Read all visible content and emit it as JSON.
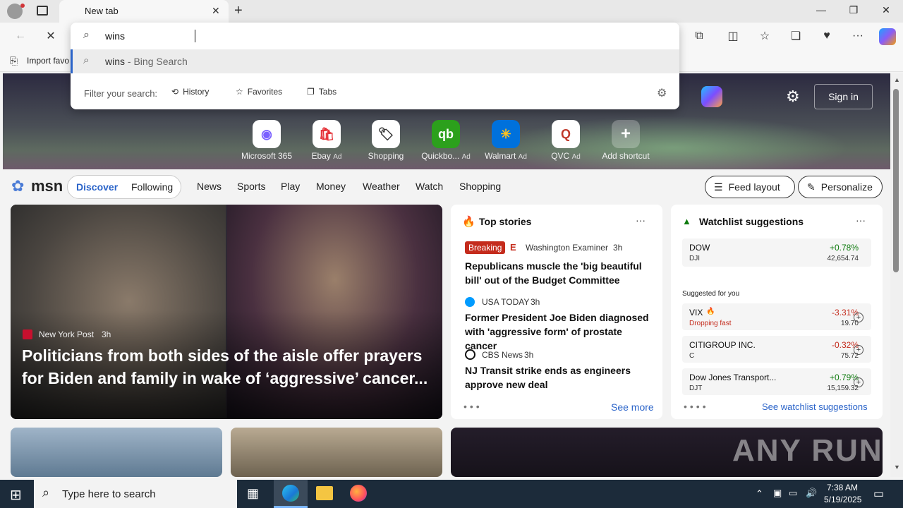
{
  "browser": {
    "tab_title": "New tab",
    "fav_label": "Import favo",
    "omnibox": {
      "input_value": "wins",
      "suggestion_query": "wins",
      "suggestion_sub": " - Bing Search",
      "filter_label": "Filter your search:",
      "filters": [
        "History",
        "Favorites",
        "Tabs"
      ]
    }
  },
  "shortcuts": [
    {
      "label": "Microsoft 365",
      "ad": "",
      "icon": "microsoft-365-icon"
    },
    {
      "label": "Ebay",
      "ad": "Ad",
      "icon": "ebay-icon"
    },
    {
      "label": "Shopping",
      "ad": "",
      "icon": "shopping-tag-icon"
    },
    {
      "label": "Quickbo...",
      "ad": "Ad",
      "icon": "quickbooks-icon"
    },
    {
      "label": "Walmart",
      "ad": "Ad",
      "icon": "walmart-icon"
    },
    {
      "label": "QVC",
      "ad": "Ad",
      "icon": "qvc-icon"
    },
    {
      "label": "Add shortcut",
      "ad": "",
      "icon": "plus-icon"
    }
  ],
  "header": {
    "sign_in": "Sign in"
  },
  "msn": {
    "logo": "msn",
    "tabs": [
      "Discover",
      "Following"
    ],
    "nav": [
      "News",
      "Sports",
      "Play",
      "Money",
      "Weather",
      "Watch",
      "Shopping"
    ],
    "feed_layout": "Feed layout",
    "personalize": "Personalize"
  },
  "hero_story": {
    "source": "New York Post",
    "age": "3h",
    "headline": "Politicians from both sides of the aisle offer prayers for Biden and family in wake of ‘aggressive’ cancer..."
  },
  "top_stories": {
    "title": "Top stories",
    "items": [
      {
        "badge": "Breaking",
        "source": "Washington Examiner",
        "age": "3h",
        "headline": "Republicans muscle the 'big beautiful bill' out of the Budget Committee"
      },
      {
        "badge": "",
        "source": "USA TODAY",
        "age": "3h",
        "headline": "Former President Joe Biden diagnosed with 'aggressive form' of prostate cancer"
      },
      {
        "badge": "",
        "source": "CBS News",
        "age": "3h",
        "headline": "NJ Transit strike ends as engineers approve new deal"
      }
    ],
    "see_more": "See more"
  },
  "watchlist": {
    "title": "Watchlist suggestions",
    "top": {
      "name": "DOW",
      "ticker": "DJI",
      "change": "+0.78%",
      "value": "42,654.74"
    },
    "suggested_label": "Suggested for you",
    "items": [
      {
        "name": "VIX",
        "ticker": "Dropping fast",
        "change": "-3.31%",
        "value": "19.70",
        "down": true
      },
      {
        "name": "CITIGROUP INC.",
        "ticker": "C",
        "change": "-0.32%",
        "value": "75.72",
        "down": true
      },
      {
        "name": "Dow Jones Transport...",
        "ticker": "DJT",
        "change": "+0.79%",
        "value": "15,159.32",
        "down": false
      }
    ],
    "see_link": "See watchlist suggestions"
  },
  "watermark": "ANY RUN",
  "taskbar": {
    "search_placeholder": "Type here to search",
    "time": "7:38 AM",
    "date": "5/19/2025"
  },
  "colors": {
    "accent": "#2b64c9",
    "positive": "#0f7b0f",
    "negative": "#c42b1c",
    "breaking": "#c42b1c"
  }
}
